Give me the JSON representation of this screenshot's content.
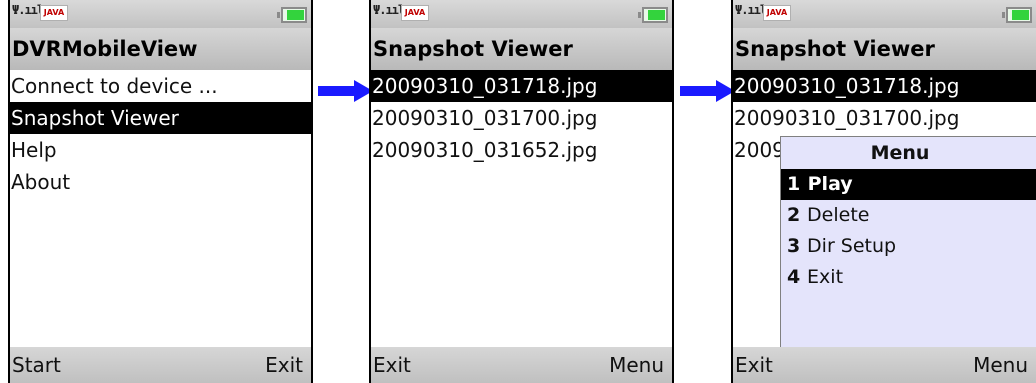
{
  "screens": [
    {
      "title": "DVRMobileView",
      "items": [
        {
          "label": "Connect to device ...",
          "selected": false
        },
        {
          "label": "Snapshot Viewer",
          "selected": true
        },
        {
          "label": "Help",
          "selected": false
        },
        {
          "label": "About",
          "selected": false
        }
      ],
      "soft_left": "Start",
      "soft_right": "Exit"
    },
    {
      "title": "Snapshot Viewer",
      "items": [
        {
          "label": "20090310_031718.jpg",
          "selected": true
        },
        {
          "label": "20090310_031700.jpg",
          "selected": false
        },
        {
          "label": "20090310_031652.jpg",
          "selected": false
        }
      ],
      "soft_left": "Exit",
      "soft_right": "Menu"
    },
    {
      "title": "Snapshot Viewer",
      "items": [
        {
          "label": "20090310_031718.jpg",
          "selected": true
        },
        {
          "label": "20090310_031700.jpg",
          "selected": false
        },
        {
          "label": "20090310_031652.jpg",
          "selected": false
        }
      ],
      "soft_left": "Exit",
      "soft_right": "Menu",
      "menu": {
        "title": "Menu",
        "items": [
          {
            "num": "1",
            "label": "Play",
            "selected": true
          },
          {
            "num": "2",
            "label": "Delete",
            "selected": false
          },
          {
            "num": "3",
            "label": "Dir Setup",
            "selected": false
          },
          {
            "num": "4",
            "label": "Exit",
            "selected": false
          }
        ]
      }
    }
  ],
  "status": {
    "java_label": "JAVA"
  },
  "colors": {
    "arrow": "#1a1aff",
    "selection": "#000000",
    "menu_bg": "#e4e4fb"
  },
  "icons": [
    "signal-strength-icon",
    "java-logo-icon",
    "battery-icon",
    "right-arrow-icon"
  ]
}
